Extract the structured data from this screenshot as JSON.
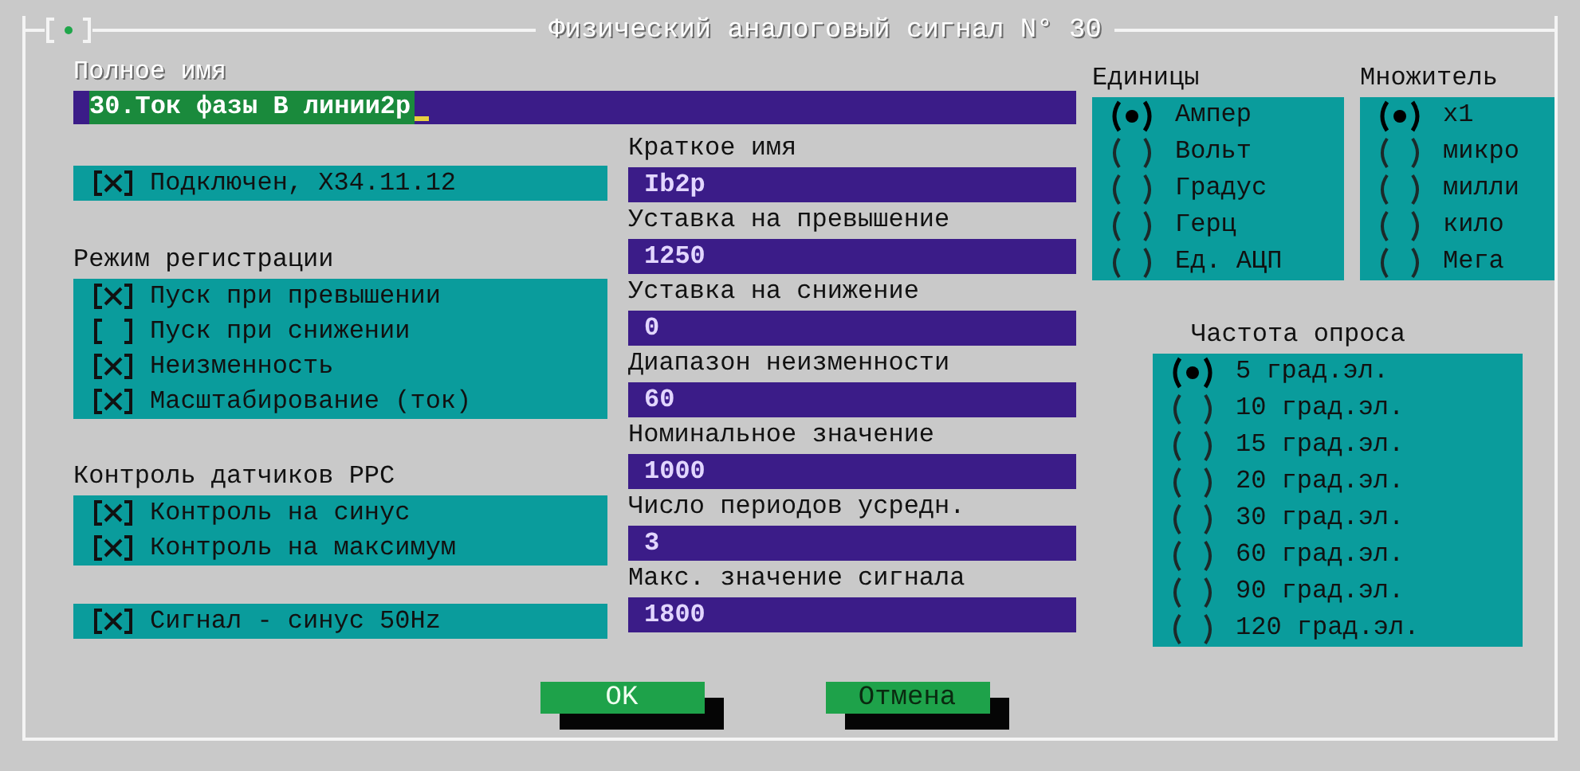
{
  "window": {
    "title": "Физический аналоговый сигнал N° 30"
  },
  "full_name": {
    "label": "Полное имя",
    "value": "30.Ток фазы В линии2р"
  },
  "connected": {
    "label": "Подключен, Х34.11.12",
    "checked": true
  },
  "registration": {
    "title": "Режим регистрации",
    "options": [
      {
        "label": "Пуск при превышении",
        "checked": true
      },
      {
        "label": "Пуск при снижении",
        "checked": false
      },
      {
        "label": "Неизменность",
        "checked": true
      },
      {
        "label": "Масштабирование (ток)",
        "checked": true
      }
    ]
  },
  "sensor_control": {
    "title": "Контроль датчиков PPC",
    "options": [
      {
        "label": "Контроль на синус",
        "checked": true
      },
      {
        "label": "Контроль на максимум",
        "checked": true
      }
    ]
  },
  "sine_signal": {
    "label": "Сигнал - синус 50Hz",
    "checked": true
  },
  "fields": [
    {
      "label": "Краткое имя",
      "value": "Ib2p"
    },
    {
      "label": "Уставка на превышение",
      "value": "1250"
    },
    {
      "label": "Уставка на снижение",
      "value": "0"
    },
    {
      "label": "Диапазон неизменности",
      "value": "60"
    },
    {
      "label": "Номинальное значение",
      "value": "1000"
    },
    {
      "label": "Число периодов усредн.",
      "value": "3"
    },
    {
      "label": "Макс. значение сигнала",
      "value": "1800"
    }
  ],
  "units": {
    "title": "Единицы",
    "options": [
      {
        "label": "Ампер",
        "selected": true
      },
      {
        "label": "Вольт",
        "selected": false
      },
      {
        "label": "Градус",
        "selected": false
      },
      {
        "label": "Герц",
        "selected": false
      },
      {
        "label": "Ед. АЦП",
        "selected": false
      }
    ]
  },
  "multiplier": {
    "title": "Множитель",
    "options": [
      {
        "label": "x1",
        "selected": true
      },
      {
        "label": "микро",
        "selected": false
      },
      {
        "label": "милли",
        "selected": false
      },
      {
        "label": "кило",
        "selected": false
      },
      {
        "label": "Мега",
        "selected": false
      }
    ]
  },
  "poll_rate": {
    "title": "Частота опроса",
    "options": [
      {
        "label": "5 град.эл.",
        "selected": true
      },
      {
        "label": "10 град.эл.",
        "selected": false
      },
      {
        "label": "15 град.эл.",
        "selected": false
      },
      {
        "label": "20 град.эл.",
        "selected": false
      },
      {
        "label": "30 град.эл.",
        "selected": false
      },
      {
        "label": "60 град.эл.",
        "selected": false
      },
      {
        "label": "90 град.эл.",
        "selected": false
      },
      {
        "label": "120 град.эл.",
        "selected": false
      }
    ]
  },
  "buttons": [
    {
      "label": "OK",
      "kind": "primary"
    },
    {
      "label": "Отмена",
      "kind": "secondary"
    }
  ]
}
